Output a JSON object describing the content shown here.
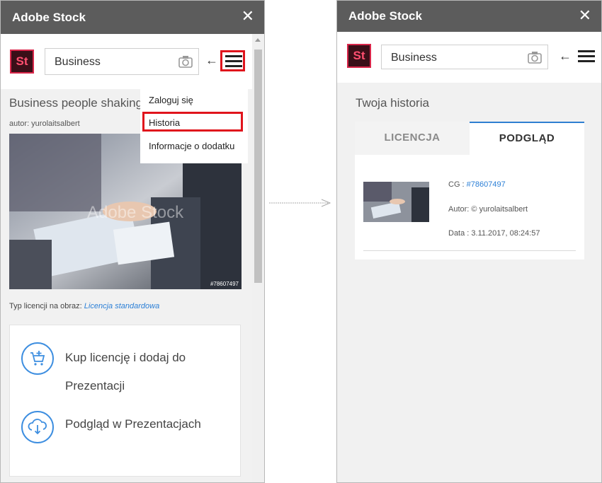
{
  "app": {
    "title": "Adobe Stock",
    "close_symbol": "✕",
    "logo_text": "St"
  },
  "search": {
    "value": "Business",
    "back_symbol": "←"
  },
  "left": {
    "image_title": "Business people shaking hands",
    "author": "autor: yurolaitsalbert",
    "watermark": "Adobe Stock",
    "image_id": "#78607497",
    "license_label": "Typ licencji na obraz: ",
    "license_link": "Licencja standardowa",
    "actions": {
      "buy": "Kup licencję i dodaj do Prezentacji",
      "preview": "Podgląd w Prezentacjach"
    },
    "menu": {
      "items": [
        "Zaloguj się",
        "Historia",
        "Informacje o dodatku"
      ]
    }
  },
  "right": {
    "history_title": "Twoja historia",
    "tabs": [
      "LICENCJA",
      "PODGLĄD"
    ],
    "entry": {
      "cg_label": "CG : ",
      "cg_value": "#78607497",
      "author": "Autor: © yurolaitsalbert",
      "date": "Data : 3.11.2017, 08:24:57"
    }
  },
  "colors": {
    "accent": "#2f7fd1",
    "highlight": "#e0141c",
    "titlebar": "#5c5c5c"
  },
  "icons": [
    "close-icon",
    "camera-icon",
    "back-arrow-icon",
    "hamburger-icon",
    "cart-add-icon",
    "cloud-download-icon"
  ]
}
